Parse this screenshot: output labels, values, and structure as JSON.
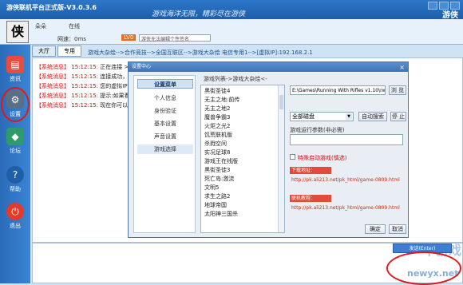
{
  "app": {
    "title": "游侠联机平台正式版-V3.0.3.6",
    "slogan": "游戏海洋无限，精彩尽在游侠",
    "brand": "游侠"
  },
  "user": {
    "avatar_text": "侠",
    "name": "朵朵",
    "status": "在线",
    "speed": "网速：0ms",
    "level": "LV0",
    "signature": "游侠无法编辑个性签名"
  },
  "tabs": [
    {
      "label": "大厅"
    },
    {
      "label": "专用"
    }
  ],
  "breadcrumb": "游戏大杂烩-->合作竞技-->全国互联区-->游戏大杂烩 电信专用1-->[虚拟IP]:192.168.2.1",
  "sidebar": {
    "items": [
      {
        "label": "资讯",
        "icon": "news-icon"
      },
      {
        "label": "设置",
        "icon": "gear-icon"
      },
      {
        "label": "论坛",
        "icon": "forum-icon"
      },
      {
        "label": "帮助",
        "icon": "help-icon"
      },
      {
        "label": "退出",
        "icon": "power-icon"
      }
    ]
  },
  "messages": [
    {
      "tag": "【系统消息】",
      "time": "15:12:15:",
      "text": "正在连接 >> 游戏"
    },
    {
      "tag": "【系统消息】",
      "time": "15:12:15:",
      "text": "连接成功，您已经"
    },
    {
      "tag": "【系统消息】",
      "time": "15:12:15:",
      "text": "您的虚拟IP为：19"
    },
    {
      "tag": "【系统消息】",
      "time": "15:12:15:",
      "text": "提示:如果看不到其"
    },
    {
      "tag": "【系统消息】",
      "time": "15:12:15:",
      "text": "现在你可以屏蔽她"
    }
  ],
  "send": {
    "label": "发送(Enter)"
  },
  "dialog": {
    "title": "设置中心",
    "close": "×",
    "nav": [
      {
        "label": "设置菜单"
      },
      {
        "label": "个人信息"
      },
      {
        "label": "身份验证"
      },
      {
        "label": "基本设置"
      },
      {
        "label": "声音设置"
      },
      {
        "label": "游戏选择"
      }
    ],
    "list_caption": "游戏列表->游戏大杂烩<-",
    "games": [
      "黑街圣徒4",
      "无主之地:前传",
      "无主之地2",
      "魔兽争霸3",
      "火炬之光2",
      "饥荒联机版",
      "杀戮空间",
      "实况足球8",
      "游戏王在线版",
      "黑街圣徒3",
      "死亡岛:激流",
      "文明5",
      "求生之路2",
      "地球帝国",
      "太阳神三国杀"
    ],
    "path_value": "E:\\Games\\Running With Rifles v1.10\\rwr_g",
    "browse": "浏 览",
    "disk_option": "全部磁盘",
    "auto_search": "自动搜索",
    "stop": "停 止",
    "params_label": "游戏运行参数(非必需)",
    "special_label": "特殊启动游戏(慎选)",
    "download_head": "下载地址：",
    "download_url": "http://pk.ali213.net/pk_html/game-0809.html",
    "forum_head": "联机教程：",
    "forum_url": "http://pk.ali213.net/pk_html/game-0809.html",
    "ok": "确定",
    "cancel": "取消"
  },
  "watermark": {
    "logo": "卡游戏",
    "site": "newyx.net"
  },
  "colors": {
    "title_bar": "#1c5eaa",
    "sidebar": "#2a6bb8",
    "system_msg": "#d01010",
    "highlight_circle": "#e01818"
  }
}
